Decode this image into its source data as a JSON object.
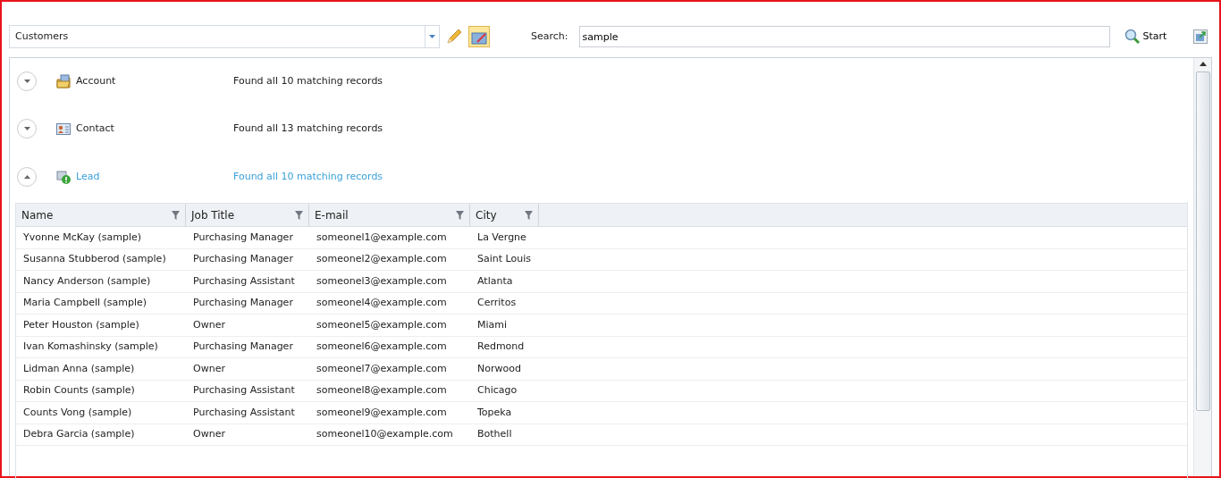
{
  "toolbar": {
    "view": "Customers",
    "search_label": "Search:",
    "search_value": "sample",
    "start_button": "Start"
  },
  "entities": [
    {
      "kind": "account",
      "name": "Account",
      "summary": "Found all 10 matching records",
      "expanded": false
    },
    {
      "kind": "contact",
      "name": "Contact",
      "summary": "Found all 13 matching records",
      "expanded": false
    },
    {
      "kind": "lead",
      "name": "Lead",
      "summary": "Found all 10 matching records",
      "expanded": true,
      "table": {
        "columns": [
          "Name",
          "Job Title",
          "E-mail",
          "City"
        ],
        "rows": [
          [
            "Yvonne McKay (sample)",
            "Purchasing Manager",
            "someonel1@example.com",
            "La Vergne"
          ],
          [
            "Susanna Stubberod (sample)",
            "Purchasing Manager",
            "someonel2@example.com",
            "Saint Louis"
          ],
          [
            "Nancy Anderson (sample)",
            "Purchasing Assistant",
            "someonel3@example.com",
            "Atlanta"
          ],
          [
            "Maria Campbell (sample)",
            "Purchasing Manager",
            "someonel4@example.com",
            "Cerritos"
          ],
          [
            "Peter Houston (sample)",
            "Owner",
            "someonel5@example.com",
            "Miami"
          ],
          [
            "Ivan Komashinsky (sample)",
            "Purchasing Manager",
            "someonel6@example.com",
            "Redmond"
          ],
          [
            "Lidman Anna (sample)",
            "Owner",
            "someonel7@example.com",
            "Norwood"
          ],
          [
            "Robin Counts (sample)",
            "Purchasing Assistant",
            "someonel8@example.com",
            "Chicago"
          ],
          [
            "Counts Vong (sample)",
            "Purchasing Assistant",
            "someonel9@example.com",
            "Topeka"
          ],
          [
            "Debra Garcia (sample)",
            "Owner",
            "someonel10@example.com",
            "Bothell"
          ]
        ]
      }
    }
  ]
}
